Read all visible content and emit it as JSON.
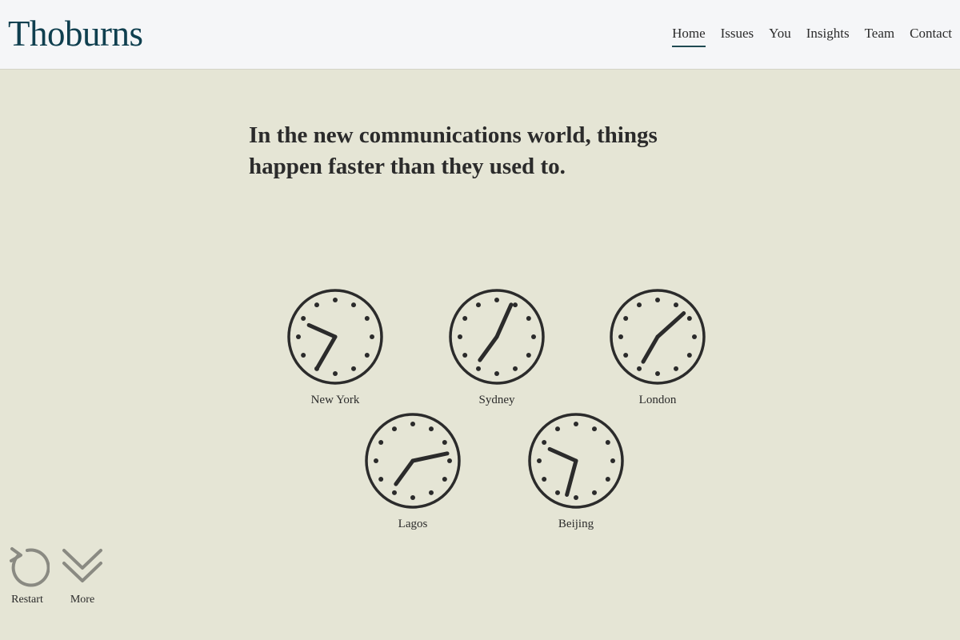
{
  "header": {
    "logo": "Thoburns",
    "nav": [
      {
        "label": "Home",
        "active": true
      },
      {
        "label": "Issues",
        "active": false
      },
      {
        "label": "You",
        "active": false
      },
      {
        "label": "Insights",
        "active": false
      },
      {
        "label": "Team",
        "active": false
      },
      {
        "label": "Contact",
        "active": false
      }
    ]
  },
  "main": {
    "headline_line1": "In the new communications world, things",
    "headline_line2": "happen faster than they used to.",
    "clocks": [
      {
        "city": "New York",
        "hour": 9.8,
        "minute": 35
      },
      {
        "city": "Sydney",
        "hour": 7.2,
        "minute": 4
      },
      {
        "city": "London",
        "hour": 7.0,
        "minute": 8
      },
      {
        "city": "Lagos",
        "hour": 7.2,
        "minute": 13
      },
      {
        "city": "Beijing",
        "hour": 9.8,
        "minute": 32.5
      }
    ]
  },
  "controls": {
    "restart_label": "Restart",
    "more_label": "More",
    "restart_icon": "restart-icon",
    "more_icon": "chevron-double-down-icon"
  },
  "colors": {
    "background": "#e5e5d5",
    "header_bg": "#f5f6f8",
    "logo": "#0f3f4f",
    "ink": "#2b2b2b",
    "control_icon": "#8a8a82"
  }
}
